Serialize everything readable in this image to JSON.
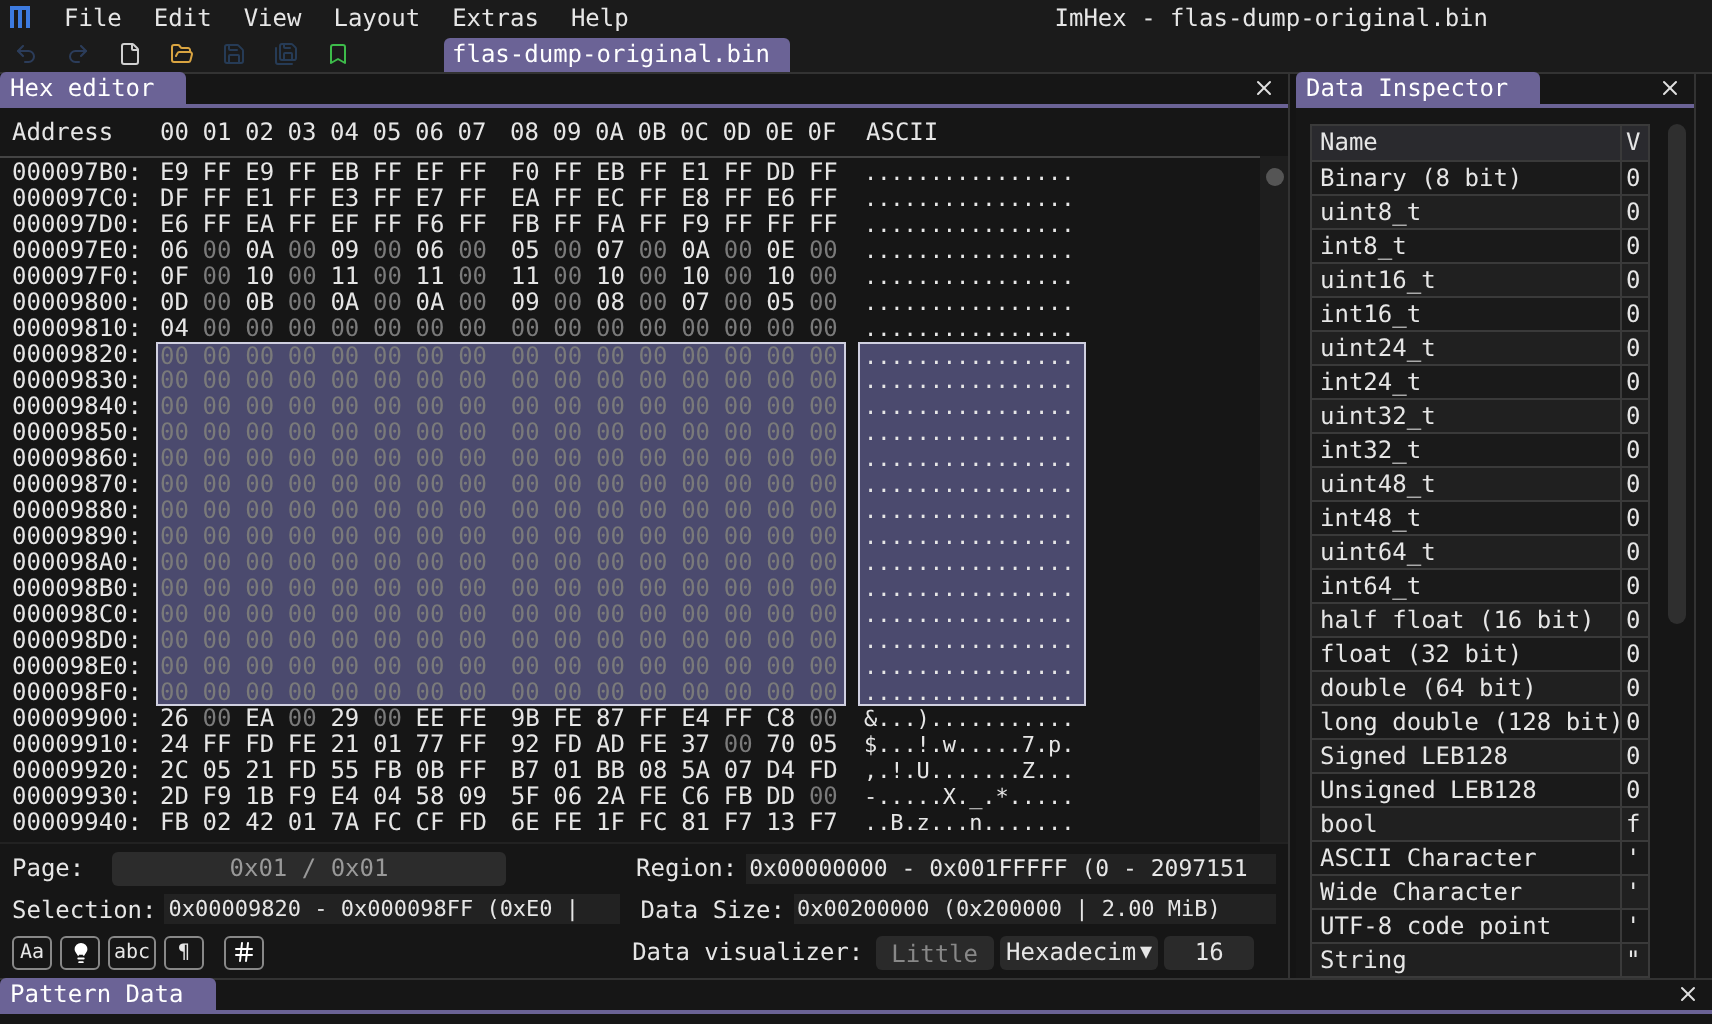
{
  "menu": [
    "File",
    "Edit",
    "View",
    "Layout",
    "Extras",
    "Help"
  ],
  "window_title": "ImHex - flas-dump-original.bin",
  "toolbar": [
    {
      "kind": "undo",
      "disabled": true
    },
    {
      "kind": "redo",
      "disabled": true
    },
    {
      "kind": "new-file",
      "disabled": false
    },
    {
      "kind": "open-folder",
      "disabled": false
    },
    {
      "kind": "save",
      "disabled": true
    },
    {
      "kind": "save-as",
      "disabled": true
    },
    {
      "kind": "bookmark",
      "disabled": false
    }
  ],
  "document_tabs": [
    {
      "label": "flas-dump-original.bin",
      "selected": true
    }
  ],
  "hex_editor": {
    "title": "Hex editor",
    "columns": {
      "address": "Address",
      "offsets": [
        "00",
        "01",
        "02",
        "03",
        "04",
        "05",
        "06",
        "07",
        "08",
        "09",
        "0A",
        "0B",
        "0C",
        "0D",
        "0E",
        "0F"
      ],
      "ascii": "ASCII"
    },
    "rows": [
      {
        "address": "000097B0:",
        "bytes": "E9 FF E9 FF EB FF EF FF F0 FF EB FF E1 FF DD FF",
        "ascii": "................",
        "selected": false
      },
      {
        "address": "000097C0:",
        "bytes": "DF FF E1 FF E3 FF E7 FF EA FF EC FF E8 FF E6 FF",
        "ascii": "................",
        "selected": false
      },
      {
        "address": "000097D0:",
        "bytes": "E6 FF EA FF EF FF F6 FF FB FF FA FF F9 FF FF FF",
        "ascii": "................",
        "selected": false
      },
      {
        "address": "000097E0:",
        "bytes": "06 00 0A 00 09 00 06 00 05 00 07 00 0A 00 0E 00",
        "ascii": "................",
        "selected": false
      },
      {
        "address": "000097F0:",
        "bytes": "0F 00 10 00 11 00 11 00 11 00 10 00 10 00 10 00",
        "ascii": "................",
        "selected": false
      },
      {
        "address": "00009800:",
        "bytes": "0D 00 0B 00 0A 00 0A 00 09 00 08 00 07 00 05 00",
        "ascii": "................",
        "selected": false
      },
      {
        "address": "00009810:",
        "bytes": "04 00 00 00 00 00 00 00 00 00 00 00 00 00 00 00",
        "ascii": "................",
        "selected": false
      },
      {
        "address": "00009820:",
        "bytes": "00 00 00 00 00 00 00 00 00 00 00 00 00 00 00 00",
        "ascii": "................",
        "selected": true
      },
      {
        "address": "00009830:",
        "bytes": "00 00 00 00 00 00 00 00 00 00 00 00 00 00 00 00",
        "ascii": "................",
        "selected": true
      },
      {
        "address": "00009840:",
        "bytes": "00 00 00 00 00 00 00 00 00 00 00 00 00 00 00 00",
        "ascii": "................",
        "selected": true
      },
      {
        "address": "00009850:",
        "bytes": "00 00 00 00 00 00 00 00 00 00 00 00 00 00 00 00",
        "ascii": "................",
        "selected": true
      },
      {
        "address": "00009860:",
        "bytes": "00 00 00 00 00 00 00 00 00 00 00 00 00 00 00 00",
        "ascii": "................",
        "selected": true
      },
      {
        "address": "00009870:",
        "bytes": "00 00 00 00 00 00 00 00 00 00 00 00 00 00 00 00",
        "ascii": "................",
        "selected": true
      },
      {
        "address": "00009880:",
        "bytes": "00 00 00 00 00 00 00 00 00 00 00 00 00 00 00 00",
        "ascii": "................",
        "selected": true
      },
      {
        "address": "00009890:",
        "bytes": "00 00 00 00 00 00 00 00 00 00 00 00 00 00 00 00",
        "ascii": "................",
        "selected": true
      },
      {
        "address": "000098A0:",
        "bytes": "00 00 00 00 00 00 00 00 00 00 00 00 00 00 00 00",
        "ascii": "................",
        "selected": true
      },
      {
        "address": "000098B0:",
        "bytes": "00 00 00 00 00 00 00 00 00 00 00 00 00 00 00 00",
        "ascii": "................",
        "selected": true
      },
      {
        "address": "000098C0:",
        "bytes": "00 00 00 00 00 00 00 00 00 00 00 00 00 00 00 00",
        "ascii": "................",
        "selected": true
      },
      {
        "address": "000098D0:",
        "bytes": "00 00 00 00 00 00 00 00 00 00 00 00 00 00 00 00",
        "ascii": "................",
        "selected": true
      },
      {
        "address": "000098E0:",
        "bytes": "00 00 00 00 00 00 00 00 00 00 00 00 00 00 00 00",
        "ascii": "................",
        "selected": true
      },
      {
        "address": "000098F0:",
        "bytes": "00 00 00 00 00 00 00 00 00 00 00 00 00 00 00 00",
        "ascii": "................",
        "selected": true
      },
      {
        "address": "00009900:",
        "bytes": "26 00 EA 00 29 00 EE FE 9B FE 87 FF E4 FF C8 00",
        "ascii": "&...)...........",
        "selected": false
      },
      {
        "address": "00009910:",
        "bytes": "24 FF FD FE 21 01 77 FF 92 FD AD FE 37 00 70 05",
        "ascii": "$...!.w.....7.p.",
        "selected": false
      },
      {
        "address": "00009920:",
        "bytes": "2C 05 21 FD 55 FB 0B FF B7 01 BB 08 5A 07 D4 FD",
        "ascii": ",.!.U.......Z...",
        "selected": false
      },
      {
        "address": "00009930:",
        "bytes": "2D F9 1B F9 E4 04 58 09 5F 06 2A FE C6 FB DD 00",
        "ascii": "-.....X._.*.....",
        "selected": false
      },
      {
        "address": "00009940:",
        "bytes": "FB 02 42 01 7A FC CF FD 6E FE 1F FC 81 F7 13 F7",
        "ascii": "..B.z...n.......",
        "selected": false
      }
    ],
    "page_label": "Page:",
    "page_value": "0x01 / 0x01",
    "region_label": "Region:",
    "region_value": "0x00000000 - 0x001FFFFF (0 - 2097151",
    "selection_label": "Selection:",
    "selection_value": "0x00009820 - 0x000098FF (0xE0 |",
    "data_size_label": "Data Size:",
    "data_size_value": "0x00200000 (0x200000 | 2.00 MiB)",
    "visualizer_label": "Data visualizer:",
    "endian": "Little",
    "format": "Hexadecim",
    "format_arrow": "▼",
    "bytes_per_row": "16",
    "tool_buttons": [
      {
        "kind": "text",
        "label": "Aa"
      },
      {
        "kind": "lightbulb"
      },
      {
        "kind": "text",
        "label": "abc"
      },
      {
        "kind": "text",
        "label": "¶"
      },
      {
        "kind": "hash"
      }
    ]
  },
  "data_inspector": {
    "title": "Data Inspector",
    "columns": [
      "Name",
      "V"
    ],
    "rows": [
      {
        "name": "Binary (8 bit)",
        "value": "0"
      },
      {
        "name": "uint8_t",
        "value": "0"
      },
      {
        "name": "int8_t",
        "value": "0"
      },
      {
        "name": "uint16_t",
        "value": "0"
      },
      {
        "name": "int16_t",
        "value": "0"
      },
      {
        "name": "uint24_t",
        "value": "0"
      },
      {
        "name": "int24_t",
        "value": "0"
      },
      {
        "name": "uint32_t",
        "value": "0"
      },
      {
        "name": "int32_t",
        "value": "0"
      },
      {
        "name": "uint48_t",
        "value": "0"
      },
      {
        "name": "int48_t",
        "value": "0"
      },
      {
        "name": "uint64_t",
        "value": "0"
      },
      {
        "name": "int64_t",
        "value": "0"
      },
      {
        "name": "half float (16 bit)",
        "value": "0"
      },
      {
        "name": "float (32 bit)",
        "value": "0"
      },
      {
        "name": "double (64 bit)",
        "value": "0"
      },
      {
        "name": "long double (128 bit)",
        "value": "0"
      },
      {
        "name": "Signed LEB128",
        "value": "0"
      },
      {
        "name": "Unsigned LEB128",
        "value": "0"
      },
      {
        "name": "bool",
        "value": "f"
      },
      {
        "name": "ASCII Character",
        "value": "'"
      },
      {
        "name": "Wide Character",
        "value": "'"
      },
      {
        "name": "UTF-8 code point",
        "value": "'"
      },
      {
        "name": "String",
        "value": "\""
      }
    ]
  },
  "pattern_data": {
    "title": "Pattern Data"
  }
}
